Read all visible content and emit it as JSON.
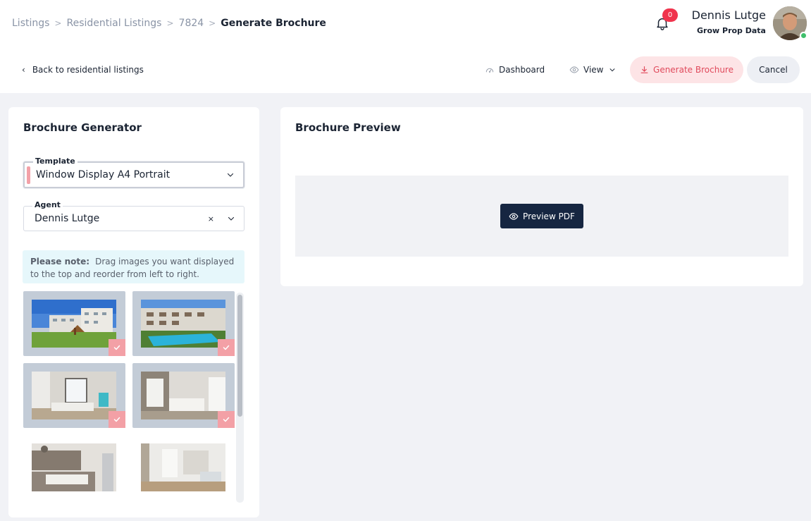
{
  "breadcrumb": {
    "items": [
      "Listings",
      "Residential Listings",
      "7824"
    ],
    "current": "Generate Brochure"
  },
  "user": {
    "name": "Dennis Lutge",
    "org": "Grow Prop Data",
    "notifications": "0"
  },
  "actions": {
    "back": "Back to residential listings",
    "dashboard": "Dashboard",
    "view": "View",
    "generate": "Generate Brochure",
    "cancel": "Cancel"
  },
  "generator": {
    "title": "Brochure Generator",
    "template_label": "Template",
    "template_value": "Window Display A4 Portrait",
    "agent_label": "Agent",
    "agent_value": "Dennis Lutge",
    "clear_symbol": "×",
    "note_label": "Please note:",
    "note_text": "Drag images you want displayed to the top and reorder from left to right."
  },
  "preview": {
    "title": "Brochure Preview",
    "button": "Preview PDF"
  },
  "colors": {
    "accent": "#e04a5c",
    "accent_bg": "#fde4e6",
    "primary_dark": "#162641",
    "badge": "#f0344d",
    "online": "#3fbf6b",
    "selected_check": "#f3a0a6"
  },
  "gallery": [
    {
      "scene": "exterior-playground",
      "selected": true
    },
    {
      "scene": "exterior-pool",
      "selected": true
    },
    {
      "scene": "living-room",
      "selected": true
    },
    {
      "scene": "kitchen-open",
      "selected": true
    },
    {
      "scene": "kitchen",
      "selected": false
    },
    {
      "scene": "dining-hallway",
      "selected": false
    }
  ]
}
